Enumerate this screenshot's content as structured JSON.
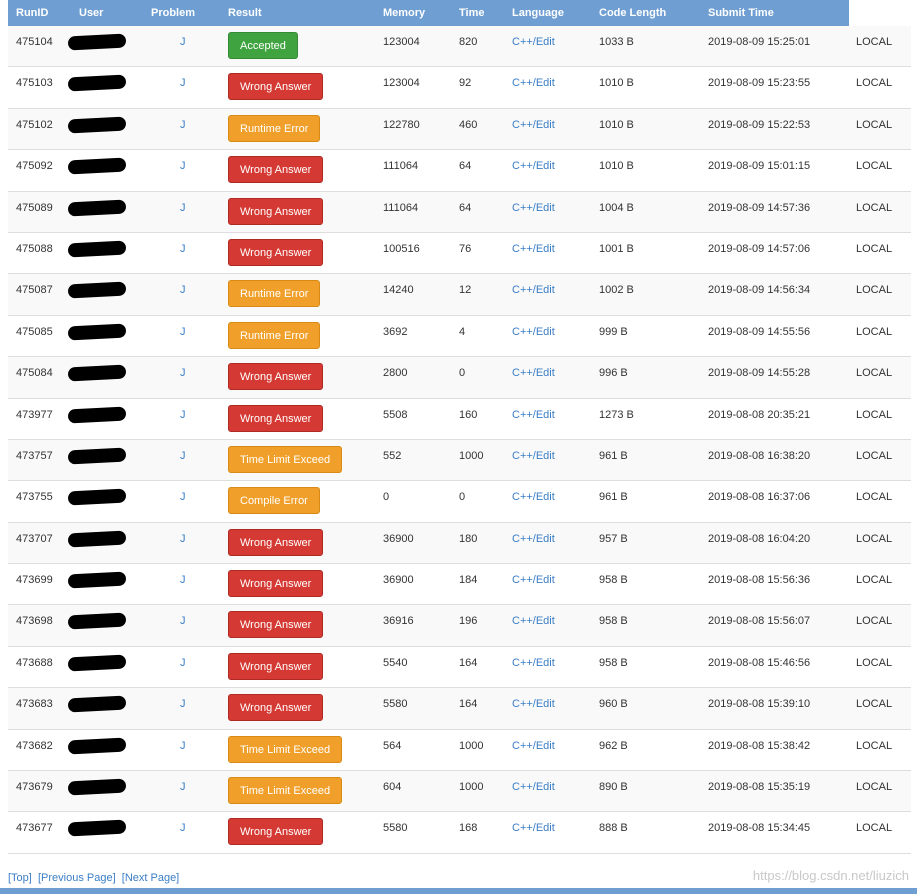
{
  "columns": {
    "runid": "RunID",
    "user": "User",
    "problem": "Problem",
    "result": "Result",
    "memory": "Memory",
    "time": "Time",
    "language": "Language",
    "code_length": "Code Length",
    "submit_time": "Submit Time"
  },
  "rows": [
    {
      "runid": "475104",
      "problem": "J",
      "result": "Accepted",
      "result_type": "ac",
      "memory": "123004",
      "time": "820",
      "language": "C++/Edit",
      "length": "1033 B",
      "submit": "2019-08-09 15:25:01",
      "judge": "LOCAL"
    },
    {
      "runid": "475103",
      "problem": "J",
      "result": "Wrong Answer",
      "result_type": "wa",
      "memory": "123004",
      "time": "92",
      "language": "C++/Edit",
      "length": "1010 B",
      "submit": "2019-08-09 15:23:55",
      "judge": "LOCAL"
    },
    {
      "runid": "475102",
      "problem": "J",
      "result": "Runtime Error",
      "result_type": "re",
      "memory": "122780",
      "time": "460",
      "language": "C++/Edit",
      "length": "1010 B",
      "submit": "2019-08-09 15:22:53",
      "judge": "LOCAL"
    },
    {
      "runid": "475092",
      "problem": "J",
      "result": "Wrong Answer",
      "result_type": "wa",
      "memory": "111064",
      "time": "64",
      "language": "C++/Edit",
      "length": "1010 B",
      "submit": "2019-08-09 15:01:15",
      "judge": "LOCAL"
    },
    {
      "runid": "475089",
      "problem": "J",
      "result": "Wrong Answer",
      "result_type": "wa",
      "memory": "111064",
      "time": "64",
      "language": "C++/Edit",
      "length": "1004 B",
      "submit": "2019-08-09 14:57:36",
      "judge": "LOCAL"
    },
    {
      "runid": "475088",
      "problem": "J",
      "result": "Wrong Answer",
      "result_type": "wa",
      "memory": "100516",
      "time": "76",
      "language": "C++/Edit",
      "length": "1001 B",
      "submit": "2019-08-09 14:57:06",
      "judge": "LOCAL"
    },
    {
      "runid": "475087",
      "problem": "J",
      "result": "Runtime Error",
      "result_type": "re",
      "memory": "14240",
      "time": "12",
      "language": "C++/Edit",
      "length": "1002 B",
      "submit": "2019-08-09 14:56:34",
      "judge": "LOCAL"
    },
    {
      "runid": "475085",
      "problem": "J",
      "result": "Runtime Error",
      "result_type": "re",
      "memory": "3692",
      "time": "4",
      "language": "C++/Edit",
      "length": "999 B",
      "submit": "2019-08-09 14:55:56",
      "judge": "LOCAL"
    },
    {
      "runid": "475084",
      "problem": "J",
      "result": "Wrong Answer",
      "result_type": "wa",
      "memory": "2800",
      "time": "0",
      "language": "C++/Edit",
      "length": "996 B",
      "submit": "2019-08-09 14:55:28",
      "judge": "LOCAL"
    },
    {
      "runid": "473977",
      "problem": "J",
      "result": "Wrong Answer",
      "result_type": "wa",
      "memory": "5508",
      "time": "160",
      "language": "C++/Edit",
      "length": "1273 B",
      "submit": "2019-08-08 20:35:21",
      "judge": "LOCAL"
    },
    {
      "runid": "473757",
      "problem": "J",
      "result": "Time Limit Exceed",
      "result_type": "re",
      "memory": "552",
      "time": "1000",
      "language": "C++/Edit",
      "length": "961 B",
      "submit": "2019-08-08 16:38:20",
      "judge": "LOCAL"
    },
    {
      "runid": "473755",
      "problem": "J",
      "result": "Compile Error",
      "result_type": "ce",
      "memory": "0",
      "time": "0",
      "language": "C++/Edit",
      "length": "961 B",
      "submit": "2019-08-08 16:37:06",
      "judge": "LOCAL"
    },
    {
      "runid": "473707",
      "problem": "J",
      "result": "Wrong Answer",
      "result_type": "wa",
      "memory": "36900",
      "time": "180",
      "language": "C++/Edit",
      "length": "957 B",
      "submit": "2019-08-08 16:04:20",
      "judge": "LOCAL"
    },
    {
      "runid": "473699",
      "problem": "J",
      "result": "Wrong Answer",
      "result_type": "wa",
      "memory": "36900",
      "time": "184",
      "language": "C++/Edit",
      "length": "958 B",
      "submit": "2019-08-08 15:56:36",
      "judge": "LOCAL"
    },
    {
      "runid": "473698",
      "problem": "J",
      "result": "Wrong Answer",
      "result_type": "wa",
      "memory": "36916",
      "time": "196",
      "language": "C++/Edit",
      "length": "958 B",
      "submit": "2019-08-08 15:56:07",
      "judge": "LOCAL"
    },
    {
      "runid": "473688",
      "problem": "J",
      "result": "Wrong Answer",
      "result_type": "wa",
      "memory": "5540",
      "time": "164",
      "language": "C++/Edit",
      "length": "958 B",
      "submit": "2019-08-08 15:46:56",
      "judge": "LOCAL"
    },
    {
      "runid": "473683",
      "problem": "J",
      "result": "Wrong Answer",
      "result_type": "wa",
      "memory": "5580",
      "time": "164",
      "language": "C++/Edit",
      "length": "960 B",
      "submit": "2019-08-08 15:39:10",
      "judge": "LOCAL"
    },
    {
      "runid": "473682",
      "problem": "J",
      "result": "Time Limit Exceed",
      "result_type": "re",
      "memory": "564",
      "time": "1000",
      "language": "C++/Edit",
      "length": "962 B",
      "submit": "2019-08-08 15:38:42",
      "judge": "LOCAL"
    },
    {
      "runid": "473679",
      "problem": "J",
      "result": "Time Limit Exceed",
      "result_type": "re",
      "memory": "604",
      "time": "1000",
      "language": "C++/Edit",
      "length": "890 B",
      "submit": "2019-08-08 15:35:19",
      "judge": "LOCAL"
    },
    {
      "runid": "473677",
      "problem": "J",
      "result": "Wrong Answer",
      "result_type": "wa",
      "memory": "5580",
      "time": "168",
      "language": "C++/Edit",
      "length": "888 B",
      "submit": "2019-08-08 15:34:45",
      "judge": "LOCAL"
    }
  ],
  "footer": {
    "top": "[Top]",
    "prev": "[Previous Page]",
    "next": "[Next Page]",
    "watermark": "https://blog.csdn.net/liuzich"
  },
  "colors": {
    "header": "#6f9fd2",
    "accepted": "#3fa33f",
    "wrong_answer": "#d43a33",
    "warning": "#f0a02a",
    "link": "#3a7ec6"
  }
}
